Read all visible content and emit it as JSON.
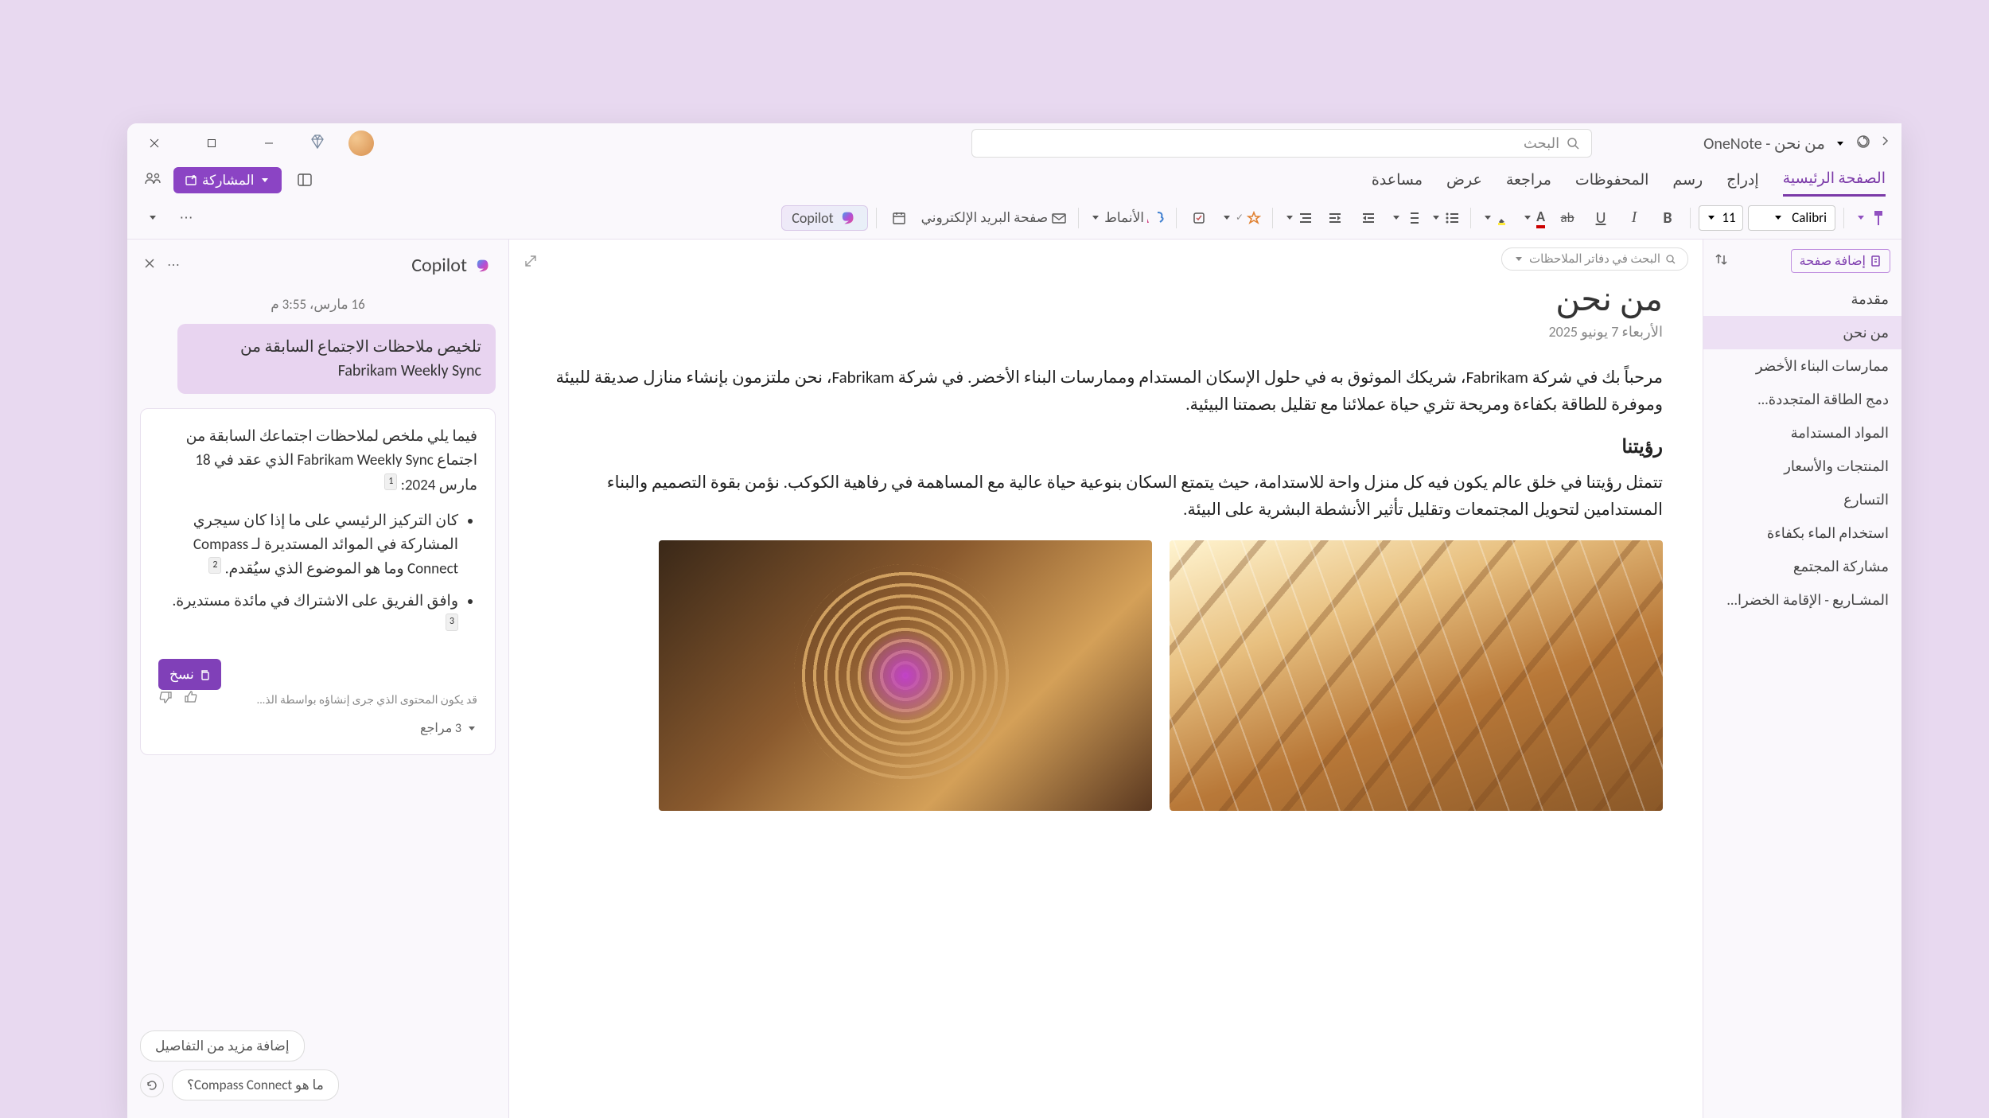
{
  "titlebar": {
    "app_title": "من نحن - OneNote",
    "search_placeholder": "البحث"
  },
  "ribbon": {
    "tabs": [
      "الصفحة الرئيسية",
      "إدراج",
      "رسم",
      "المحفوظات",
      "مراجعة",
      "عرض",
      "مساعدة"
    ],
    "active_tab_index": 0,
    "share_label": "المشاركة"
  },
  "toolbar": {
    "font_name": "Calibri",
    "font_size": "11",
    "styles_label": "الأنماط",
    "email_page_label": "صفحة البريد الإلكتروني",
    "copilot_label": "Copilot"
  },
  "page_sidebar": {
    "add_page": "إضافة صفحة",
    "items": [
      {
        "label": "مقدمة"
      },
      {
        "label": "من نحن"
      },
      {
        "label": "ممارسات البناء الأخضر"
      },
      {
        "label": "دمج الطاقة المتجددة..."
      },
      {
        "label": "المواد المستدامة"
      },
      {
        "label": "المنتجات والأسعار"
      },
      {
        "label": "التسارع"
      },
      {
        "label": "استخدام الماء بكفاءة"
      },
      {
        "label": "مشاركة المجتمع"
      },
      {
        "label": "المشـاريع - الإقامة الخضرا..."
      }
    ],
    "active_index": 1
  },
  "document": {
    "search_notebooks": "البحث في دفاتر الملاحظات",
    "title": "من نحن",
    "date": "الأربعاء 7 يونيو 2025",
    "para1": "مرحباً بك في شركة Fabrikam، شريكك الموثوق به في حلول الإسكان المستدام وممارسات البناء الأخضر. في شركة Fabrikam، نحن ملتزمون بإنشاء منازل صديقة للبيئة وموفرة للطاقة بكفاءة ومريحة تثري حياة عملائنا مع تقليل بصمتنا البيئية.",
    "h2": "رؤيتنا",
    "para2": "تتمثل رؤيتنا في خلق عالم يكون فيه كل منزل واحة للاستدامة، حيث يتمتع السكان بنوعية حياة عالية مع المساهمة في رفاهية الكوكب. نؤمن بقوة التصميم والبناء المستدامين لتحويل المجتمعات وتقليل تأثير الأنشطة البشرية على البيئة."
  },
  "copilot": {
    "title": "Copilot",
    "timestamp": "16 مارس، 3:55 م",
    "user_prompt": "تلخيص ملاحظات الاجتماع السابقة من Fabrikam Weekly Sync",
    "response_intro": "فيما يلي ملخص لملاحظات اجتماعك السابقة من اجتماع Fabrikam Weekly Sync الذي عقد في 18 مارس 2024:",
    "bullets": [
      "كان التركيز الرئيسي على ما إذا كان سيجري المشاركة في الموائد المستديرة لـ Compass Connect وما هو الموضوع الذي سيُقدم.",
      "وافق الفريق على الاشتراك في مائدة مستديرة."
    ],
    "refs": [
      "1",
      "2",
      "3"
    ],
    "copy_label": "نسخ",
    "disclaimer": "قد يكون المحتوى الذي جرى إنشاؤه بواسطة الذ...",
    "references_link": "3 مراجع",
    "suggestion1": "إضافة مزيد من التفاصيل",
    "suggestion2": "ما هو Compass Connect؟"
  }
}
